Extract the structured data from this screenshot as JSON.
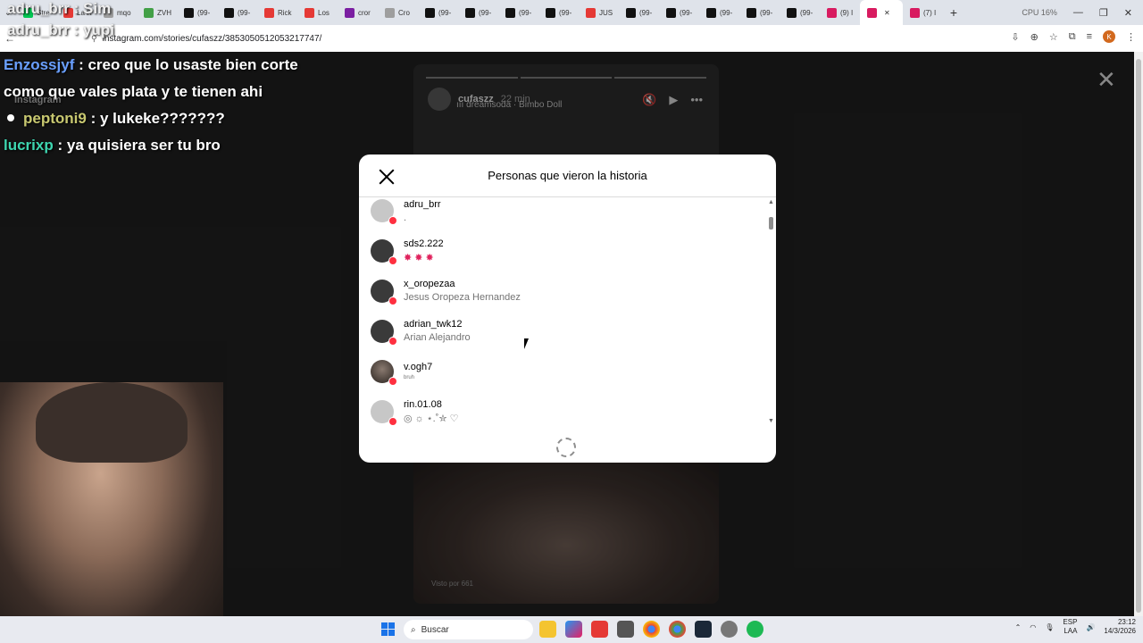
{
  "browser": {
    "tabs": [
      {
        "label": "Stre",
        "color": "#00c853"
      },
      {
        "label": "La R",
        "color": "#e53935"
      },
      {
        "label": "mqo",
        "color": "#9e9e9e"
      },
      {
        "label": "ZVH",
        "color": "#43a047"
      },
      {
        "label": "(99-",
        "color": "#111111"
      },
      {
        "label": "(99-",
        "color": "#111111"
      },
      {
        "label": "Rick",
        "color": "#e53935"
      },
      {
        "label": "Los",
        "color": "#e53935"
      },
      {
        "label": "cror",
        "color": "#7b1fa2"
      },
      {
        "label": "Cro",
        "color": "#9e9e9e"
      },
      {
        "label": "(99-",
        "color": "#111111"
      },
      {
        "label": "(99-",
        "color": "#111111"
      },
      {
        "label": "(99-",
        "color": "#111111"
      },
      {
        "label": "(99-",
        "color": "#111111"
      },
      {
        "label": "JUS",
        "color": "#e53935"
      },
      {
        "label": "(99-",
        "color": "#111111"
      },
      {
        "label": "(99-",
        "color": "#111111"
      },
      {
        "label": "(99-",
        "color": "#111111"
      },
      {
        "label": "(99-",
        "color": "#111111"
      },
      {
        "label": "(99-",
        "color": "#111111"
      },
      {
        "label": "(9) I",
        "color": "#d81b60"
      },
      {
        "label": "",
        "color": "#d81b60",
        "active": true
      },
      {
        "label": "(7) I",
        "color": "#d81b60"
      }
    ],
    "url": "instagram.com/stories/cufaszz/3853050512053217747/",
    "system_stats": "CPU 16%",
    "profile_initial": "K"
  },
  "overlay": {
    "caption_top": "adru_brr : Sim",
    "caption_second": "adru_brr : yupi",
    "watermark": "Instagram",
    "chat": [
      {
        "user": "Enzossjyf",
        "message": ": creo que lo usaste bien corte",
        "cont": "como que vales plata y te tienen ahi"
      },
      {
        "user": "peptoni9",
        "message": ": y lukeke???????"
      },
      {
        "user": "lucrixp",
        "message": ": ya quisiera ser tu bro"
      }
    ]
  },
  "story": {
    "username": "cufaszz",
    "time": "22 min",
    "song_artist": "dreamsoda",
    "song_title": "Bimbo Doll",
    "viewed_by": "Visto por 661"
  },
  "modal": {
    "title": "Personas que vieron la historia",
    "viewers": [
      {
        "username": "adru_brr",
        "subtitle": "."
      },
      {
        "username": "sds2.222",
        "subtitle": "✸ ✸ ✸"
      },
      {
        "username": "x_oropezaa",
        "subtitle": "Jesus Oropeza Hernandez"
      },
      {
        "username": "adrian_twk12",
        "subtitle": "Arian Alejandro"
      },
      {
        "username": "v.ogh7",
        "subtitle": "bruh"
      },
      {
        "username": "rin.01.08",
        "subtitle": "◎ ☼ ⋆.˚✮ ♡"
      }
    ]
  },
  "taskbar": {
    "search_label": "Buscar",
    "lang": "ESP",
    "lang2": "LAA",
    "time": "23:12",
    "date": "14/3/2026"
  }
}
